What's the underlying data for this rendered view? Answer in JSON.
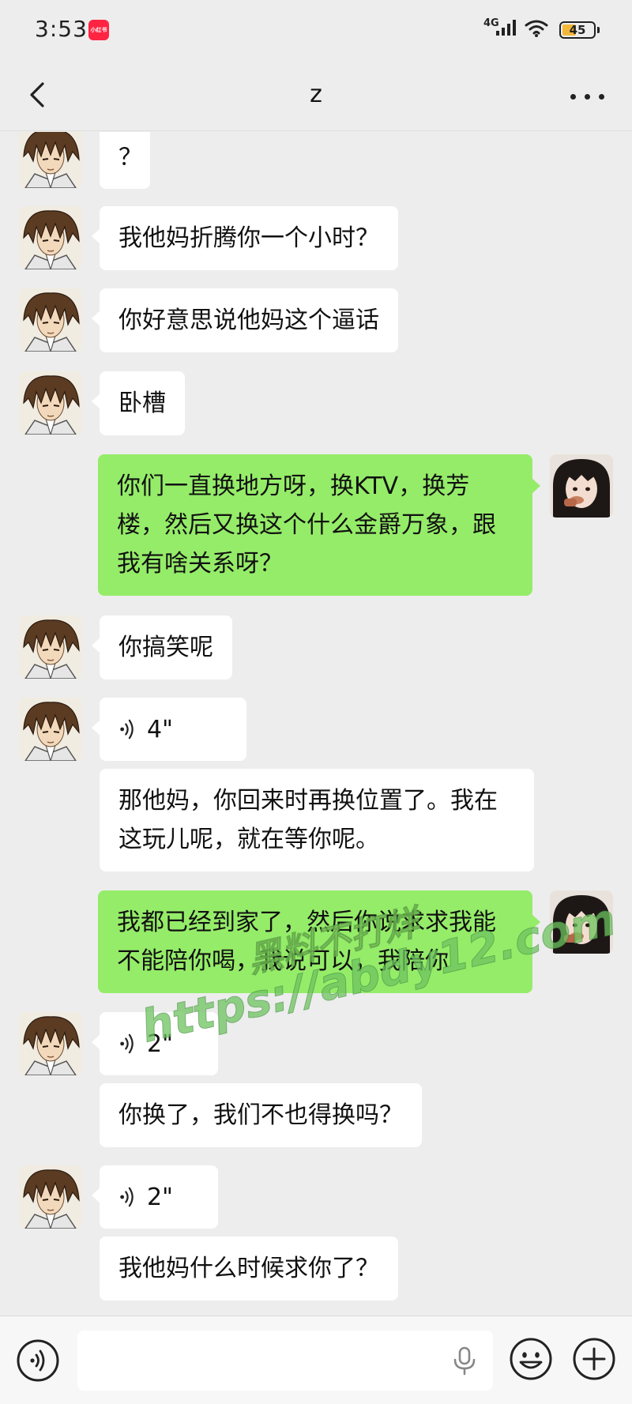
{
  "status_bar": {
    "time": "3:53",
    "app_badge": "小红书",
    "network": "4G",
    "battery": "45",
    "battery_level": 0.45,
    "icons": [
      "xiaohongshu-app-icon",
      "signal-icon",
      "wifi-icon",
      "battery-icon"
    ]
  },
  "header": {
    "title": "z",
    "back_icon": "chevron-left-icon",
    "more_icon": "more-horizontal-icon"
  },
  "messages": [
    {
      "from": "contact",
      "type": "text",
      "text": "？"
    },
    {
      "from": "contact",
      "type": "text",
      "text": "我他妈折腾你一个小时？"
    },
    {
      "from": "contact",
      "type": "text",
      "text": "你好意思说他妈这个逼话"
    },
    {
      "from": "contact",
      "type": "text",
      "text": "卧槽"
    },
    {
      "from": "me",
      "type": "text",
      "text": "你们一直换地方呀，换KTV，换芳楼，然后又换这个什么金爵万象，跟我有啥关系呀？"
    },
    {
      "from": "contact",
      "type": "text",
      "text": "你搞笑呢"
    },
    {
      "from": "contact",
      "type": "voice",
      "duration": "4\"",
      "transcript": "那他妈，你回来时再换位置了。我在这玩儿呢，就在等你呢。"
    },
    {
      "from": "me",
      "type": "text",
      "text": "我都已经到家了，然后你说求求我能不能陪你喝，我说可以，我陪你"
    },
    {
      "from": "contact",
      "type": "voice",
      "duration": "2\"",
      "transcript": "你换了，我们不也得换吗？"
    },
    {
      "from": "contact",
      "type": "voice",
      "duration": "2\"",
      "transcript": "我他妈什么时候求你了？"
    }
  ],
  "watermark": {
    "line1": "黑料不打烊",
    "line2": "https://abdy12.com"
  },
  "input_bar": {
    "icons": [
      "voice-mode-icon",
      "microphone-icon",
      "emoji-icon",
      "plus-icon"
    ]
  },
  "colors": {
    "background": "#ededed",
    "incoming_bubble": "#ffffff",
    "outgoing_bubble": "#95ec69",
    "battery_fill": "#f3b73a"
  }
}
